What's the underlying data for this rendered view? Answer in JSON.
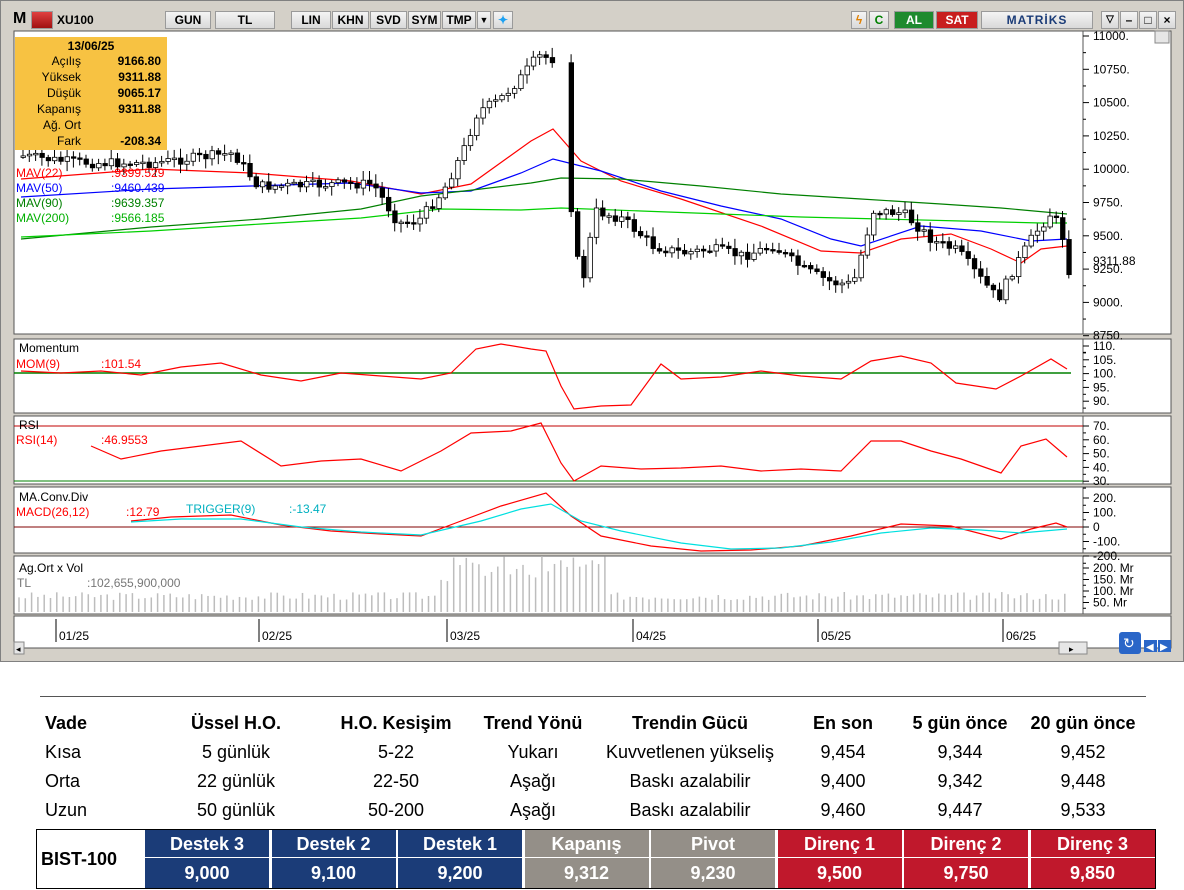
{
  "toolbar": {
    "logo": "M",
    "symbol": "XU100",
    "buttons": [
      "GUN",
      "TL",
      "LIN",
      "KHN",
      "SVD",
      "SYM",
      "TMP"
    ],
    "buy": "AL",
    "sell": "SAT",
    "brand": "MATRİKS"
  },
  "info": {
    "date": "13/06/25",
    "rows": [
      {
        "k": "Açılış",
        "v": "9166.80"
      },
      {
        "k": "Yüksek",
        "v": "9311.88"
      },
      {
        "k": "Düşük",
        "v": "9065.17"
      },
      {
        "k": "Kapanış",
        "v": "9311.88"
      },
      {
        "k": "Ağ. Ort",
        "v": ""
      },
      {
        "k": "Fark",
        "v": "-208.34"
      }
    ]
  },
  "price_panel": {
    "y_ticks": [
      "11000.",
      "10750.",
      "10500.",
      "10250.",
      "10000.",
      "9750.",
      "9500.",
      "9250.",
      "9000.",
      "8750."
    ],
    "last_label": "9311.88",
    "mav_labels": [
      {
        "name": "MAV(22)",
        "value": ":9399.529",
        "color": "#ff0000"
      },
      {
        "name": "MAV(50)",
        "value": ":9460.439",
        "color": "#0000ff"
      },
      {
        "name": "MAV(90)",
        "value": ":9639.357",
        "color": "#008000"
      },
      {
        "name": "MAV(200)",
        "value": ":9566.185",
        "color": "#00c000"
      }
    ]
  },
  "momentum": {
    "title": "Momentum",
    "label": "MOM(9)",
    "value": ":101.54",
    "ticks": [
      "110.",
      "105.",
      "100.",
      "95.",
      "90."
    ]
  },
  "rsi": {
    "title": "RSI",
    "label": "RSI(14)",
    "value": ":46.9553",
    "ticks": [
      "70.",
      "60.",
      "50.",
      "40.",
      "30."
    ]
  },
  "macd": {
    "title": "MA.Conv.Div",
    "label": "MACD(26,12)",
    "value": ":12.79",
    "trigger_label": "TRIGGER(9)",
    "trigger_value": ":-13.47",
    "ticks": [
      "200.",
      "100.",
      "0",
      "-100.",
      "-200."
    ]
  },
  "volume": {
    "title": "Ag.Ort x Vol",
    "label": "TL",
    "value": ":102,655,900,000",
    "ticks": [
      "200. Mr",
      "150. Mr",
      "100. Mr",
      "50. Mr"
    ]
  },
  "x_axis": [
    "01/25",
    "02/25",
    "03/25",
    "04/25",
    "05/25",
    "06/25"
  ],
  "table": {
    "headers": [
      "Vade",
      "Üssel H.O.",
      "H.O. Kesişim",
      "Trend Yönü",
      "Trendin Gücü",
      "En son",
      "5 gün önce",
      "20 gün önce"
    ],
    "rows": [
      [
        "Kısa",
        "5 günlük",
        "5-22",
        "Yukarı",
        "Kuvvetlenen yükseliş",
        "9,454",
        "9,344",
        "9,452"
      ],
      [
        "Orta",
        "22 günlük",
        "22-50",
        "Aşağı",
        "Baskı azalabilir",
        "9,400",
        "9,342",
        "9,448"
      ],
      [
        "Uzun",
        "50 günlük",
        "50-200",
        "Aşağı",
        "Baskı azalabilir",
        "9,460",
        "9,447",
        "9,533"
      ]
    ]
  },
  "levels": {
    "index": "BIST-100",
    "cells": [
      {
        "h": "Destek 3",
        "v": "9,000",
        "color": "#1b3c78"
      },
      {
        "h": "Destek 2",
        "v": "9,100",
        "color": "#1b3c78"
      },
      {
        "h": "Destek 1",
        "v": "9,200",
        "color": "#1b3c78"
      },
      {
        "h": "Kapanış",
        "v": "9,312",
        "color": "#948f88"
      },
      {
        "h": "Pivot",
        "v": "9,230",
        "color": "#948f88"
      },
      {
        "h": "Direnç 1",
        "v": "9,500",
        "color": "#c0182c"
      },
      {
        "h": "Direnç 2",
        "v": "9,750",
        "color": "#c0182c"
      },
      {
        "h": "Direnç 3",
        "v": "9,850",
        "color": "#c0182c"
      }
    ]
  }
}
